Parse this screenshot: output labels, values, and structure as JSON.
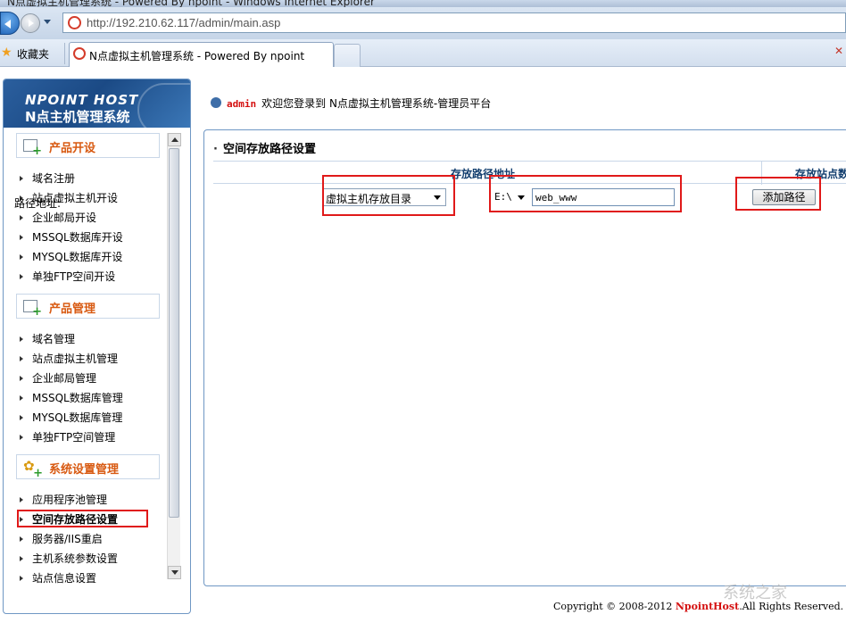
{
  "window": {
    "title": "N点虚拟主机管理系统 - Powered By npoint - Windows Internet Explorer"
  },
  "browser": {
    "address": "http://192.210.62.117/admin/main.asp",
    "favorites_label": "收藏夹",
    "tab_title": "N点虚拟主机管理系统 - Powered By npoint"
  },
  "logo": {
    "line1": "NPOINT HOST",
    "line2": "N点主机管理系统"
  },
  "sidebar": {
    "groups": [
      {
        "title": "产品开设",
        "items": [
          "域名注册",
          "站点虚拟主机开设",
          "企业邮局开设",
          "MSSQL数据库开设",
          "MYSQL数据库开设",
          "单独FTP空间开设"
        ]
      },
      {
        "title": "产品管理",
        "items": [
          "域名管理",
          "站点虚拟主机管理",
          "企业邮局管理",
          "MSSQL数据库管理",
          "MYSQL数据库管理",
          "单独FTP空间管理"
        ]
      },
      {
        "title": "系统设置管理",
        "items": [
          "应用程序池管理",
          "空间存放路径设置",
          "服务器/IIS重启",
          "主机系统参数设置",
          "站点信息设置"
        ]
      }
    ]
  },
  "welcome": {
    "user": "admin",
    "text": "欢迎您登录到 N点虚拟主机管理系统-管理员平台"
  },
  "panel": {
    "title": "空间存放路径设置",
    "col_path": "存放路径地址",
    "col_site": "存放站点数",
    "row_label": "路径地址:",
    "dir_select": "虚拟主机存放目录",
    "drive_select": "E:\\",
    "path_value": "web_www",
    "add_button": "添加路径"
  },
  "footer": {
    "prefix": "Copyright © 2008-2012",
    "brand": "NpointHost",
    "suffix": ".All Rights Reserved."
  },
  "watermark": "系统之家",
  "colors": {
    "highlight": "#e01919",
    "group_title": "#d85a12",
    "accent": "#6f97c4"
  }
}
